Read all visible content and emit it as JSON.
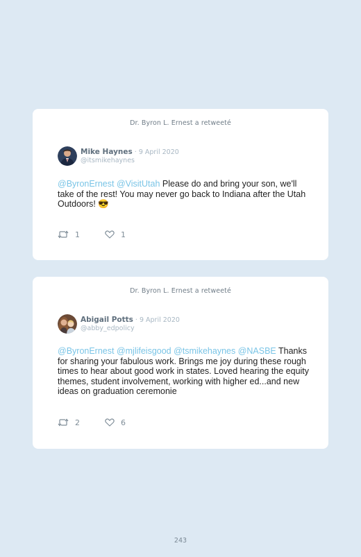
{
  "tweets": [
    {
      "retweeted_by": "Dr. Byron L. Ernest a retweeté",
      "author_name": "Mike Haynes",
      "date": " · 9 April 2020",
      "handle": "@itsmikehaynes",
      "mentions": "@ByronErnest @VisitUtah",
      "text": " Please do and bring your son, we'll take of the rest! You may never go back to Indiana after the Utah Outdoors! 😎",
      "retweets": "1",
      "likes": "1",
      "avatar_icon": "profile-photo-man-in-suit"
    },
    {
      "retweeted_by": "Dr. Byron L. Ernest a retweeté",
      "author_name": "Abigail Potts",
      "date": " · 9 April 2020",
      "handle": "@abby_edpolicy",
      "mentions": "@ByronErnest @mjlifeisgood @tsmikehaynes @NASBE",
      "text": " Thanks for sharing your fabulous work. Brings me joy during these rough times to hear about good work in states. Loved hearing the equity themes, student involvement, working with higher ed...and new ideas on graduation ceremonie",
      "retweets": "2",
      "likes": "6",
      "avatar_icon": "profile-photo-woman-with-child"
    }
  ],
  "icons": {
    "retweet": "retweet-icon",
    "like": "heart-icon"
  },
  "colors": {
    "background": "#dde9f3",
    "card": "#ffffff",
    "mention": "#79c4e6",
    "muted": "#a8b7c3"
  },
  "page_number": "243"
}
